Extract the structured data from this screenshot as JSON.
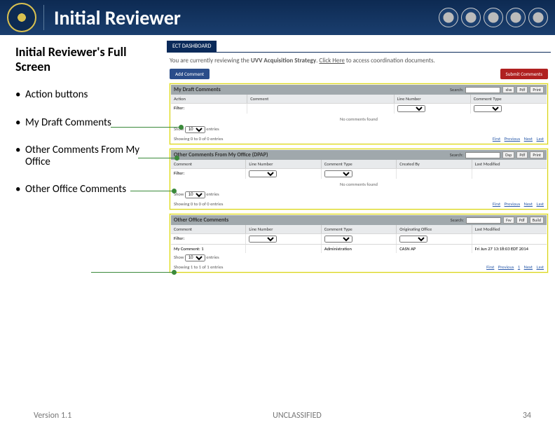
{
  "header": {
    "title": "Initial Reviewer"
  },
  "left": {
    "subtitle": "Initial Reviewer's Full Screen",
    "bullets": [
      "Action buttons",
      "My Draft Comments",
      "Other Comments From My Office",
      "Other Office Comments"
    ]
  },
  "tab": "ECT DASHBOARD",
  "review_msg": {
    "prefix": "You are currently reviewing the ",
    "doc": "UVV Acquisition Strategy",
    "mid": ". ",
    "link": "Click Here",
    "suffix": " to access coordination documents."
  },
  "buttons": {
    "add": "Add Comment",
    "submit": "Submit Comments"
  },
  "panel1": {
    "title": "My Draft Comments",
    "search_label": "Search:",
    "btns": [
      "xlsx",
      "Pdf",
      "Print"
    ],
    "cols": [
      "Action",
      "Comment",
      "Line Number",
      "Comment Type"
    ],
    "filter": "Filter:",
    "empty": "No comments found",
    "show": "Show",
    "show_val": "10",
    "entries": "entries",
    "showing": "Showing 0 to 0 of 0 entries",
    "pager": [
      "First",
      "Previous",
      "Next",
      "Last"
    ]
  },
  "panel2": {
    "title": "Other Comments From My Office (DPAP)",
    "search_label": "Search:",
    "btns": [
      "Dsp",
      "Pdf",
      "Print"
    ],
    "cols": [
      "Comment",
      "Line Number",
      "Comment Type",
      "Created By",
      "Last Modified"
    ],
    "filter": "Filter:",
    "empty": "No comments found",
    "show": "Show",
    "show_val": "10",
    "entries": "entries",
    "showing": "Showing 0 to 0 of 0 entries",
    "pager": [
      "First",
      "Previous",
      "Next",
      "Last"
    ]
  },
  "panel3": {
    "title": "Other Office Comments",
    "search_label": "Search:",
    "btns": [
      "Fsv",
      "Pdf",
      "Build"
    ],
    "cols": [
      "Comment",
      "Line Number",
      "Comment Type",
      "Originating Office",
      "Last Modified"
    ],
    "filter": "Filter:",
    "row": {
      "c1": "My Comment: 1",
      "c4": "Administration",
      "c5": "CASN AP",
      "c6": "Fri Jun 27 13:18:03 EDT 2014"
    },
    "show": "Show",
    "show_val": "10",
    "entries": "entries",
    "showing": "Showing 1 to 1 of 1 entries",
    "pager": [
      "First",
      "Previous",
      "1",
      "Next",
      "Last"
    ]
  },
  "footer": {
    "version": "Version 1.1",
    "classification": "UNCLASSIFIED",
    "page": "34"
  }
}
